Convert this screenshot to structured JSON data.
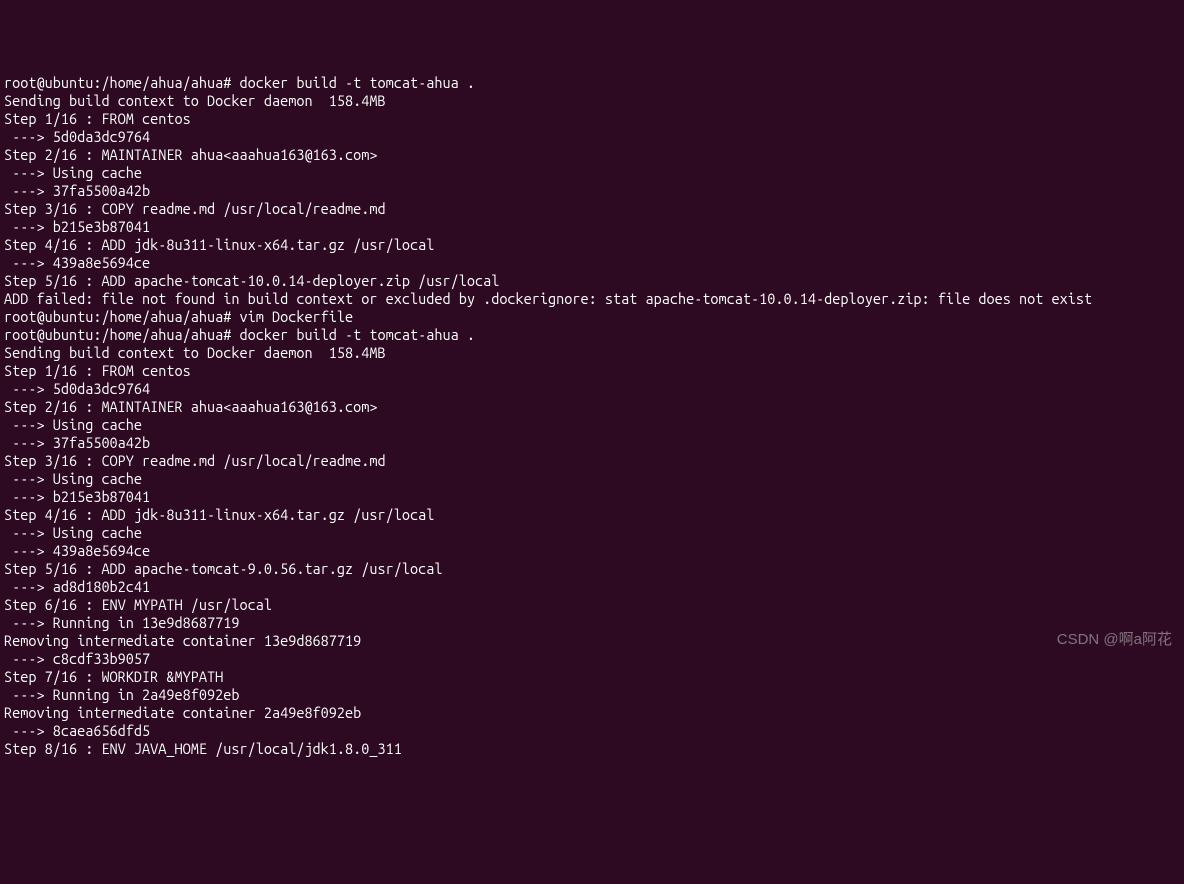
{
  "terminal": {
    "lines": [
      "root@ubuntu:/home/ahua/ahua# docker build -t tomcat-ahua .",
      "Sending build context to Docker daemon  158.4MB",
      "Step 1/16 : FROM centos",
      " ---> 5d0da3dc9764",
      "Step 2/16 : MAINTAINER ahua<aaahua163@163.com>",
      " ---> Using cache",
      " ---> 37fa5500a42b",
      "Step 3/16 : COPY readme.md /usr/local/readme.md",
      " ---> b215e3b87041",
      "Step 4/16 : ADD jdk-8u311-linux-x64.tar.gz /usr/local",
      " ---> 439a8e5694ce",
      "Step 5/16 : ADD apache-tomcat-10.0.14-deployer.zip /usr/local",
      "ADD failed: file not found in build context or excluded by .dockerignore: stat apache-tomcat-10.0.14-deployer.zip: file does not exist",
      "root@ubuntu:/home/ahua/ahua# vim Dockerfile",
      "root@ubuntu:/home/ahua/ahua# docker build -t tomcat-ahua .",
      "Sending build context to Docker daemon  158.4MB",
      "Step 1/16 : FROM centos",
      " ---> 5d0da3dc9764",
      "Step 2/16 : MAINTAINER ahua<aaahua163@163.com>",
      " ---> Using cache",
      " ---> 37fa5500a42b",
      "Step 3/16 : COPY readme.md /usr/local/readme.md",
      " ---> Using cache",
      " ---> b215e3b87041",
      "Step 4/16 : ADD jdk-8u311-linux-x64.tar.gz /usr/local",
      " ---> Using cache",
      " ---> 439a8e5694ce",
      "Step 5/16 : ADD apache-tomcat-9.0.56.tar.gz /usr/local",
      " ---> ad8d180b2c41",
      "Step 6/16 : ENV MYPATH /usr/local",
      " ---> Running in 13e9d8687719",
      "Removing intermediate container 13e9d8687719",
      " ---> c8cdf33b9057",
      "Step 7/16 : WORKDIR &MYPATH",
      " ---> Running in 2a49e8f092eb",
      "Removing intermediate container 2a49e8f092eb",
      " ---> 8caea656dfd5",
      "Step 8/16 : ENV JAVA_HOME /usr/local/jdk1.8.0_311"
    ]
  },
  "watermark": "CSDN @啊a阿花"
}
